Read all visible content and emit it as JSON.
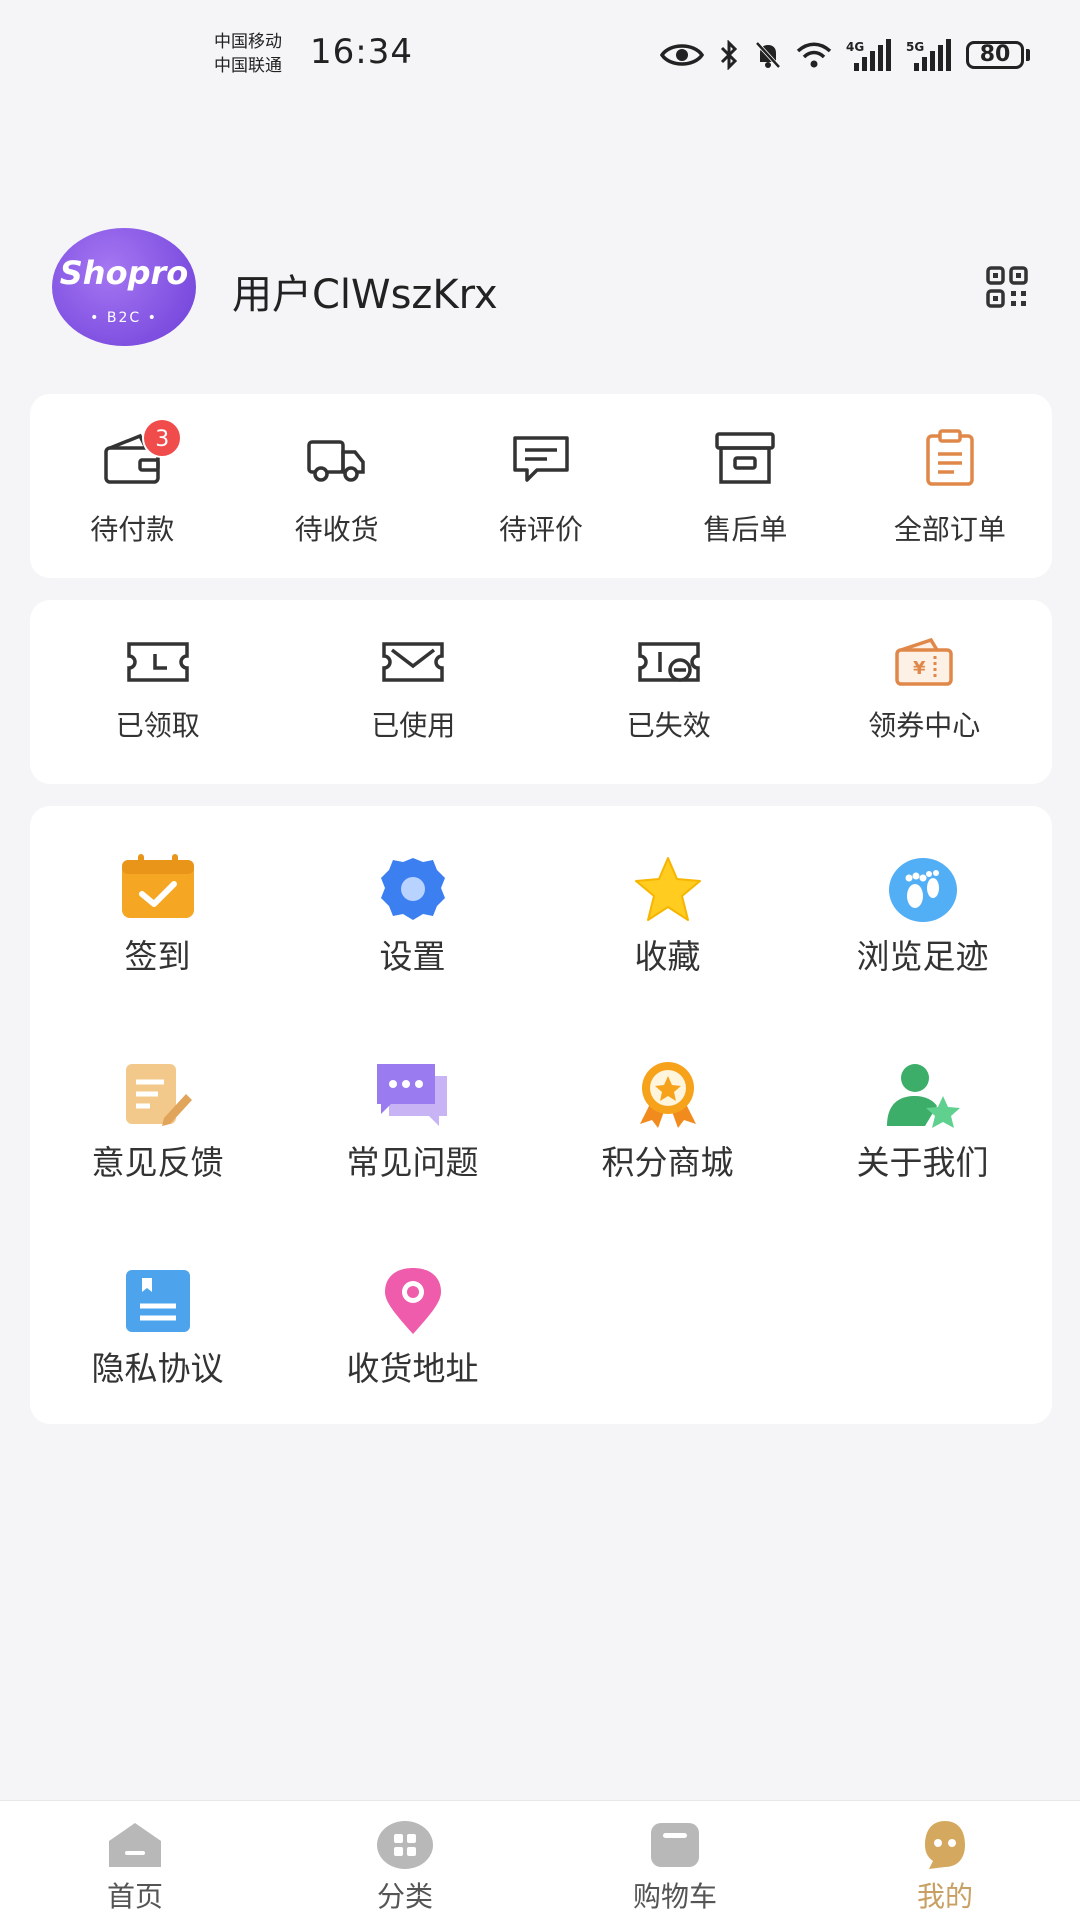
{
  "status_bar": {
    "carrier_1": "中国移动",
    "carrier_2": "中国联通",
    "time": "16:34",
    "net_1": "4G",
    "net_2": "5G",
    "battery": "80"
  },
  "profile": {
    "avatar_logo": "Shopro",
    "avatar_sub": "• B2C •",
    "username": "用户ClWszKrx"
  },
  "orders": [
    {
      "label": "待付款",
      "badge": "3",
      "icon": "wallet-icon"
    },
    {
      "label": "待收货",
      "icon": "truck-icon"
    },
    {
      "label": "待评价",
      "icon": "comment-icon"
    },
    {
      "label": "售后单",
      "icon": "box-icon"
    },
    {
      "label": "全部订单",
      "icon": "clipboard-icon"
    }
  ],
  "coupons": [
    {
      "label": "已领取",
      "icon": "ticket-icon"
    },
    {
      "label": "已使用",
      "icon": "ticket-check-icon"
    },
    {
      "label": "已失效",
      "icon": "ticket-expired-icon"
    },
    {
      "label": "领券中心",
      "icon": "coupon-wallet-icon"
    }
  ],
  "services": [
    {
      "label": "签到",
      "icon": "calendar-check-icon"
    },
    {
      "label": "设置",
      "icon": "gear-icon"
    },
    {
      "label": "收藏",
      "icon": "star-icon"
    },
    {
      "label": "浏览足迹",
      "icon": "footprint-icon"
    },
    {
      "label": "意见反馈",
      "icon": "feedback-icon"
    },
    {
      "label": "常见问题",
      "icon": "chat-bubbles-icon"
    },
    {
      "label": "积分商城",
      "icon": "medal-icon"
    },
    {
      "label": "关于我们",
      "icon": "user-star-icon"
    },
    {
      "label": "隐私协议",
      "icon": "document-icon"
    },
    {
      "label": "收货地址",
      "icon": "location-pin-icon"
    }
  ],
  "tabbar": [
    {
      "label": "首页",
      "icon": "home-icon"
    },
    {
      "label": "分类",
      "icon": "category-icon"
    },
    {
      "label": "购物车",
      "icon": "cart-icon"
    },
    {
      "label": "我的",
      "icon": "profile-face-icon",
      "active": true
    }
  ],
  "colors": {
    "accent": "#c9a063",
    "badge": "#f04c4c",
    "background": "#f5f5f7"
  }
}
